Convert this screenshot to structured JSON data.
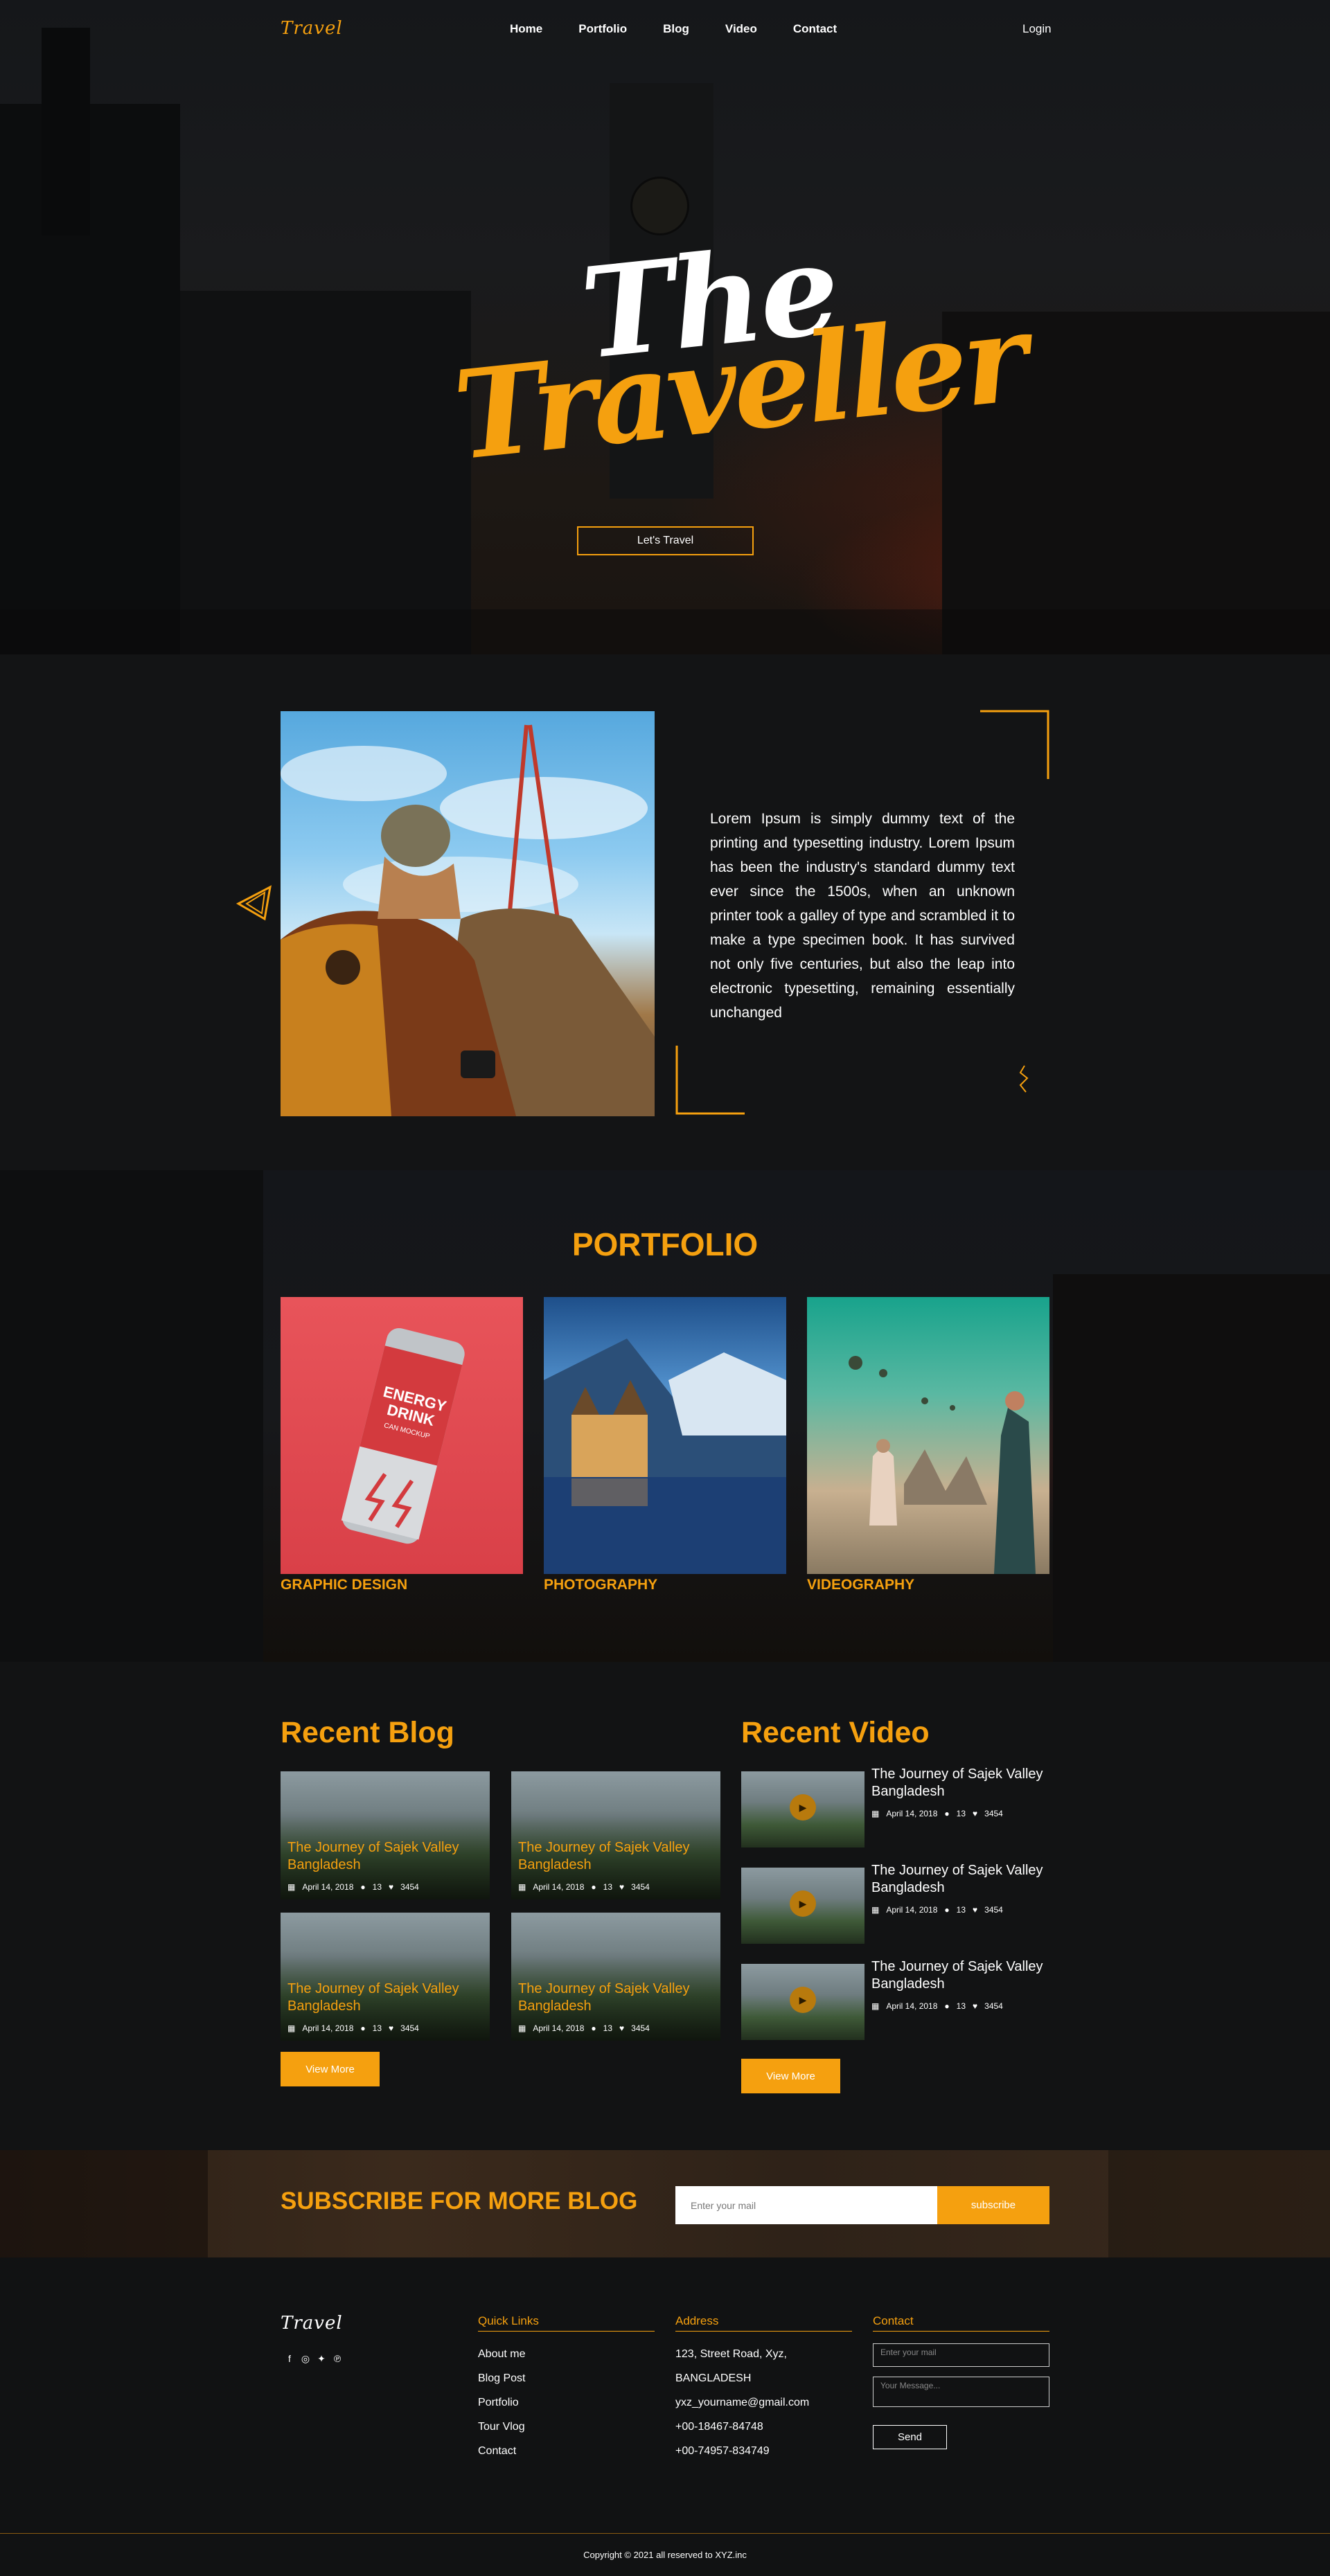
{
  "brand": {
    "logo_text": "Travel"
  },
  "nav": {
    "items": [
      "Home",
      "Portfolio",
      "Blog",
      "Video",
      "Contact"
    ],
    "login": "Login"
  },
  "hero": {
    "title_line1": "The",
    "title_line2": "Traveller",
    "cta": "Let's Travel"
  },
  "about": {
    "text": "Lorem Ipsum is simply dummy text of the printing and typesetting industry. Lorem Ipsum has been the industry's standard dummy text ever since the 1500s, when an unknown printer took a galley of type and scrambled it to make a type specimen book. It has survived not only five centuries, but also the leap into electronic typesetting, remaining essentially unchanged"
  },
  "portfolio": {
    "title": "PORTFOLIO",
    "can_text": [
      "ENERGY",
      "DRINK",
      "CAN MOCKUP"
    ],
    "items": [
      {
        "label": "GRAPHIC DESIGN"
      },
      {
        "label": "PHOTOGRAPHY"
      },
      {
        "label": "VIDEOGRAPHY"
      }
    ]
  },
  "blog": {
    "title": "Recent Blog",
    "posts": [
      {
        "title": "The Journey of Sajek Valley Bangladesh",
        "date": "April 14, 2018",
        "comments": "13",
        "likes": "3454"
      },
      {
        "title": "The Journey of Sajek Valley Bangladesh",
        "date": "April 14, 2018",
        "comments": "13",
        "likes": "3454"
      },
      {
        "title": "The Journey of Sajek Valley Bangladesh",
        "date": "April 14, 2018",
        "comments": "13",
        "likes": "3454"
      },
      {
        "title": "The Journey of Sajek Valley Bangladesh",
        "date": "April 14, 2018",
        "comments": "13",
        "likes": "3454"
      }
    ],
    "view_more": "View More"
  },
  "video": {
    "title": "Recent Video",
    "items": [
      {
        "title": "The Journey of Sajek Valley Bangladesh",
        "date": "April 14, 2018",
        "comments": "13",
        "likes": "3454"
      },
      {
        "title": "The Journey of Sajek Valley Bangladesh",
        "date": "April 14, 2018",
        "comments": "13",
        "likes": "3454"
      },
      {
        "title": "The Journey of Sajek Valley Bangladesh",
        "date": "April 14, 2018",
        "comments": "13",
        "likes": "3454"
      }
    ],
    "view_more": "View More"
  },
  "subscribe": {
    "title": "SUBSCRIBE FOR MORE BLOG",
    "placeholder": "Enter your mail",
    "button": "subscribe"
  },
  "footer": {
    "quick_links": {
      "title": "Quick Links",
      "items": [
        "About me",
        "Blog Post",
        "Portfolio",
        "Tour Vlog",
        "Contact"
      ]
    },
    "address": {
      "title": "Address",
      "lines": [
        "123, Street Road, Xyz,",
        "BANGLADESH",
        "yxz_yourname@gmail.com",
        "+00-18467-84748",
        "+00-74957-834749"
      ]
    },
    "contact": {
      "title": "Contact",
      "mail_placeholder": "Enter your mail",
      "message_placeholder": "Your Message...",
      "send": "Send"
    },
    "copyright": "Copyright © 2021 all reserved to XYZ.inc"
  },
  "colors": {
    "accent": "#f5a00f",
    "background": "#121314"
  }
}
